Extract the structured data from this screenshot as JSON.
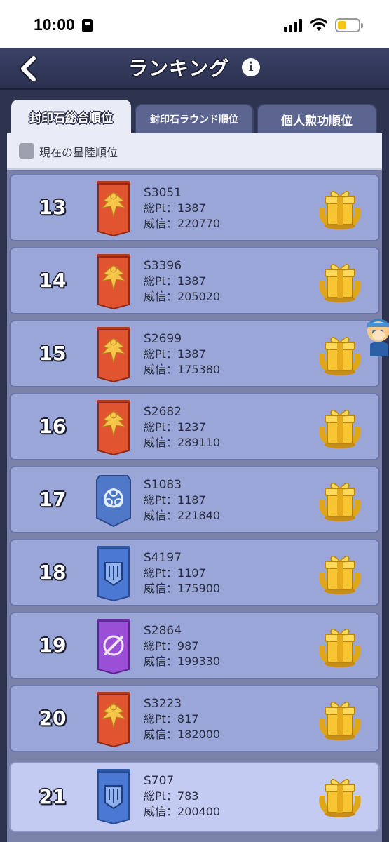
{
  "status_bar": {
    "time": "10:00"
  },
  "header": {
    "title": "ランキング"
  },
  "tabs": [
    {
      "label": "封印石総合順位",
      "active": true
    },
    {
      "label": "封印石ラウンド順位",
      "active": false
    },
    {
      "label": "個人勲功順位",
      "active": false
    }
  ],
  "filter": {
    "label": "現在の星陸順位",
    "checked": false
  },
  "rows": [
    {
      "rank": "13",
      "server": "S3051",
      "pt": "総Pt：1387",
      "prestige": "威信：220770",
      "emblem": "red-eagle-banner-icon"
    },
    {
      "rank": "14",
      "server": "S3396",
      "pt": "総Pt：1387",
      "prestige": "威信：205020",
      "emblem": "red-eagle-banner-icon"
    },
    {
      "rank": "15",
      "server": "S2699",
      "pt": "総Pt：1387",
      "prestige": "威信：175380",
      "emblem": "red-eagle-banner-icon"
    },
    {
      "rank": "16",
      "server": "S2682",
      "pt": "総Pt：1237",
      "prestige": "威信：289110",
      "emblem": "red-eagle-banner-icon"
    },
    {
      "rank": "17",
      "server": "S1083",
      "pt": "総Pt：1187",
      "prestige": "威信：221840",
      "emblem": "blue-biohazard-shield-icon"
    },
    {
      "rank": "18",
      "server": "S4197",
      "pt": "総Pt：1107",
      "prestige": "威信：175900",
      "emblem": "blue-fist-banner-icon"
    },
    {
      "rank": "19",
      "server": "S2864",
      "pt": "総Pt：987",
      "prestige": "威信：199330",
      "emblem": "purple-sword-banner-icon"
    },
    {
      "rank": "20",
      "server": "S3223",
      "pt": "総Pt：817",
      "prestige": "威信：182000",
      "emblem": "red-eagle-banner-icon"
    },
    {
      "rank": "21",
      "server": "S707",
      "pt": "総Pt：783",
      "prestige": "威信：200400",
      "emblem": "blue-fist-banner-icon",
      "highlighted": true
    }
  ],
  "colors": {
    "row_bg": "#9aa6d8",
    "row_highlight_bg": "#c3cbf3",
    "header_bg": "#2e3350",
    "gift_gold": "#f2b417"
  }
}
